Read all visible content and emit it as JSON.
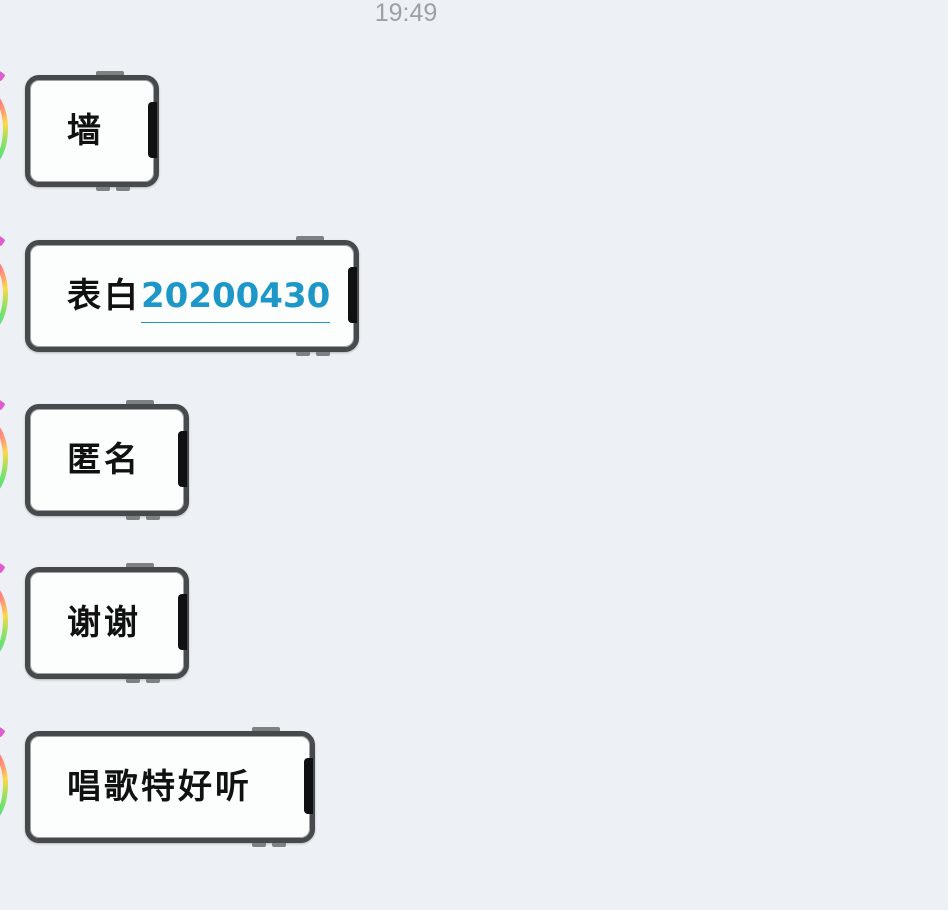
{
  "status": {
    "timestamp": "19:49"
  },
  "messages": [
    {
      "text": "墙",
      "link": ""
    },
    {
      "text": "表白",
      "link": "20200430"
    },
    {
      "text": "匿名",
      "link": ""
    },
    {
      "text": "谢谢",
      "link": ""
    },
    {
      "text": "唱歌特好听",
      "link": ""
    }
  ],
  "colors": {
    "background": "#edf1f5",
    "bubble_fill": "#fcfdfd",
    "bubble_frame": "#474a4c",
    "link": "#1c97c8",
    "timestamp": "#9ba0a6"
  },
  "icons": {
    "avatar": "rainbow-ring-avatar-icon"
  }
}
